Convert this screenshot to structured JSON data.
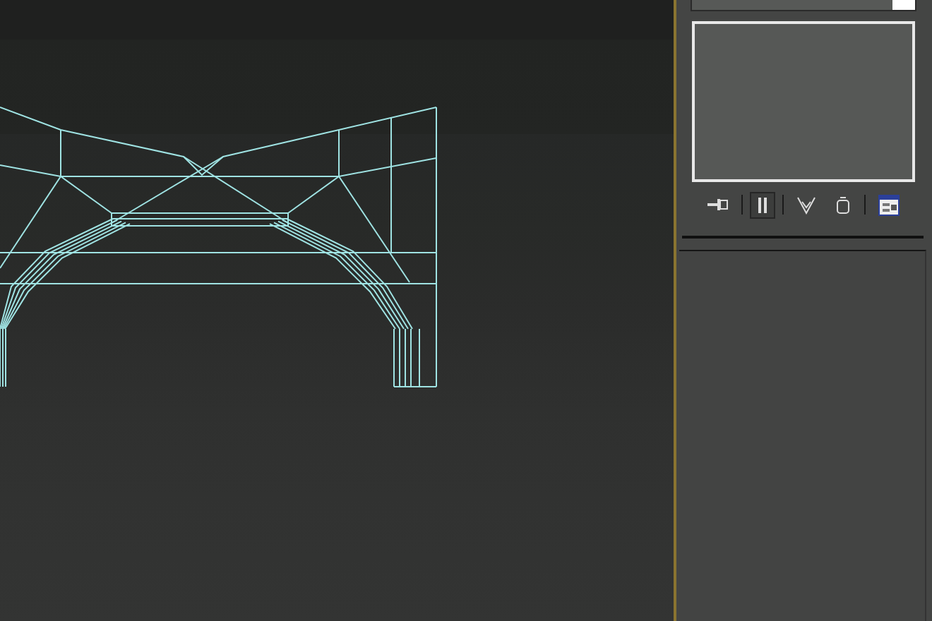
{
  "command_panel": {
    "stack_toolbar": [
      {
        "kind": "pin",
        "selected": false
      },
      {
        "kind": "bars",
        "selected": true
      },
      {
        "kind": "fork",
        "selected": false
      },
      {
        "kind": "bin",
        "selected": false
      },
      {
        "kind": "sets",
        "selected": false
      }
    ]
  }
}
